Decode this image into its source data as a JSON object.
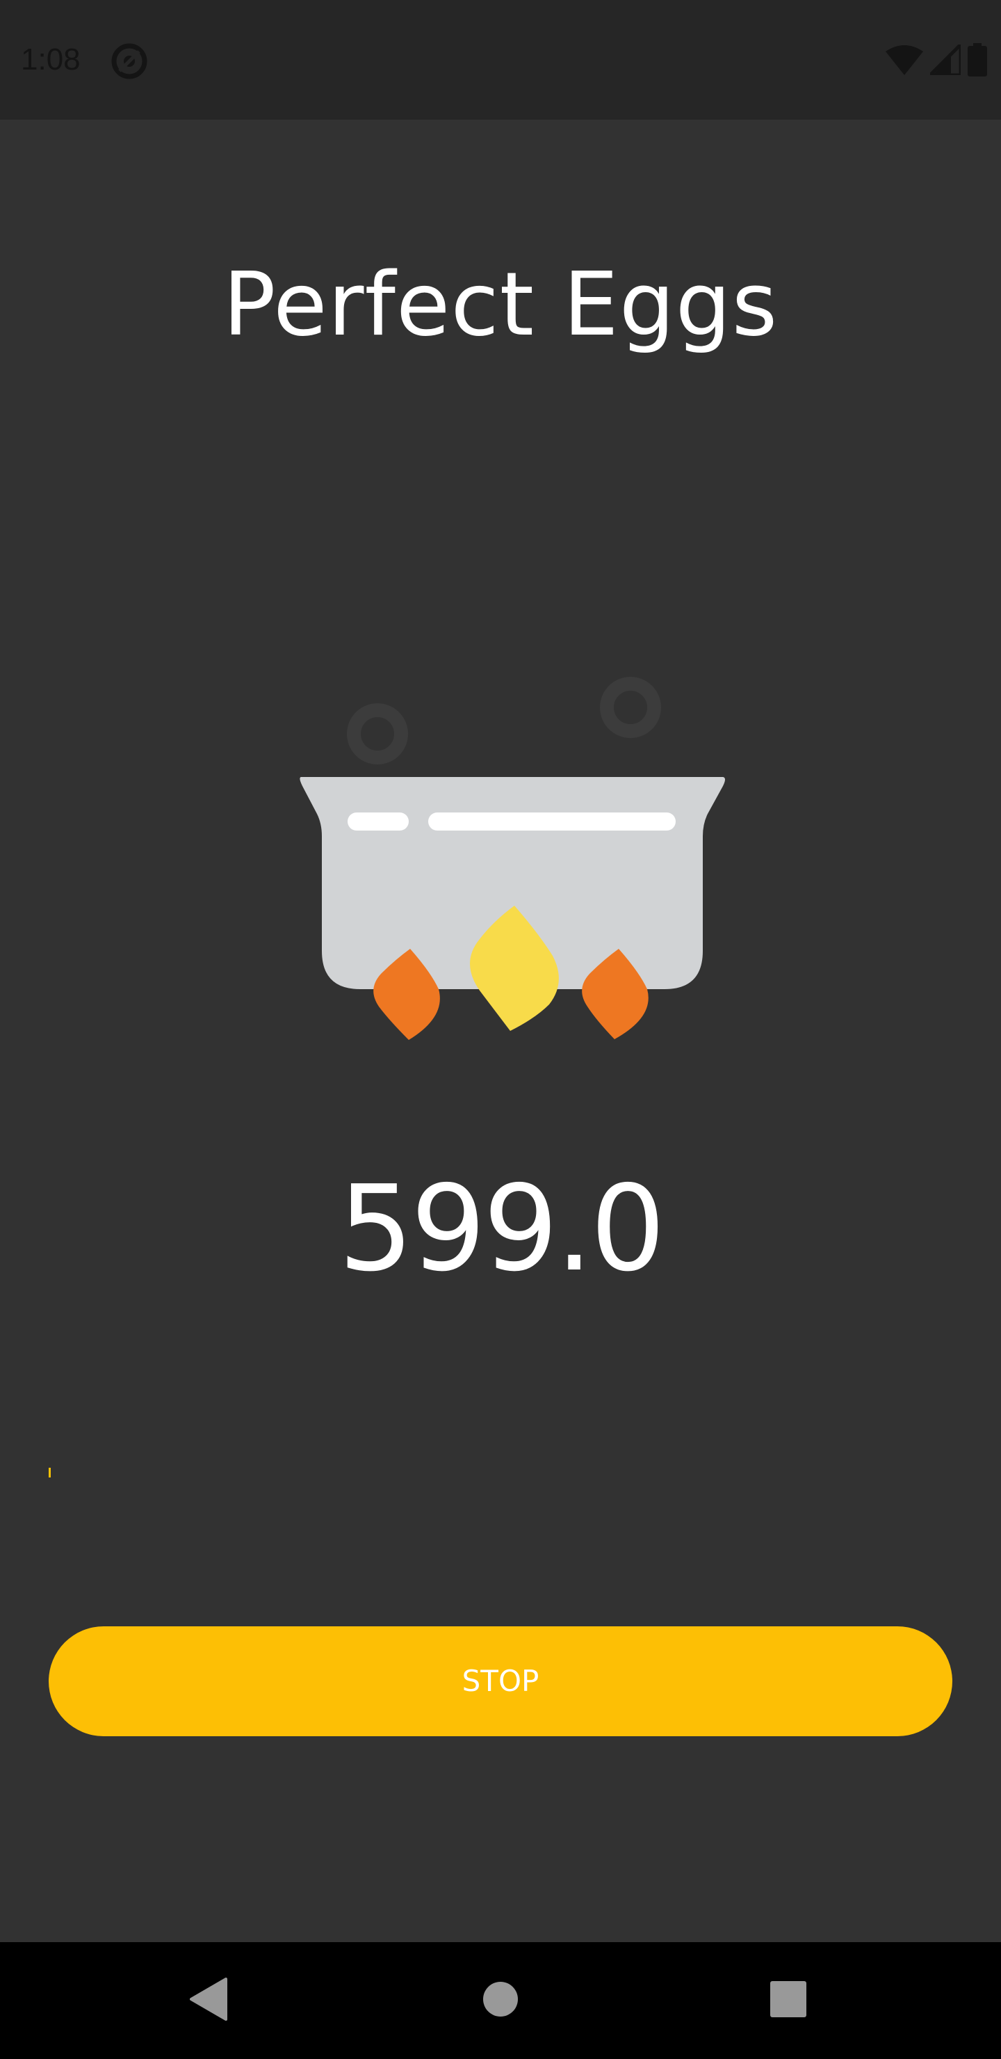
{
  "status_bar": {
    "time": "1:08",
    "left_icon": "sync-icon",
    "right_icons": [
      "wifi-icon",
      "signal-icon",
      "battery-icon"
    ]
  },
  "app": {
    "title": "Perfect Eggs",
    "illustration": "boiling-pot-icon",
    "timer": "599.0",
    "progress_fraction": 0.002,
    "stop_label": "STOP"
  },
  "nav_bar": {
    "buttons": [
      "back-icon",
      "home-icon",
      "recents-icon"
    ]
  },
  "colors": {
    "background": "#323232",
    "status_bar": "#262626",
    "accent": "#fdbf05",
    "pot": "#d1d3d5",
    "flame_orange": "#ee7722",
    "flame_yellow": "#f8db4a"
  }
}
